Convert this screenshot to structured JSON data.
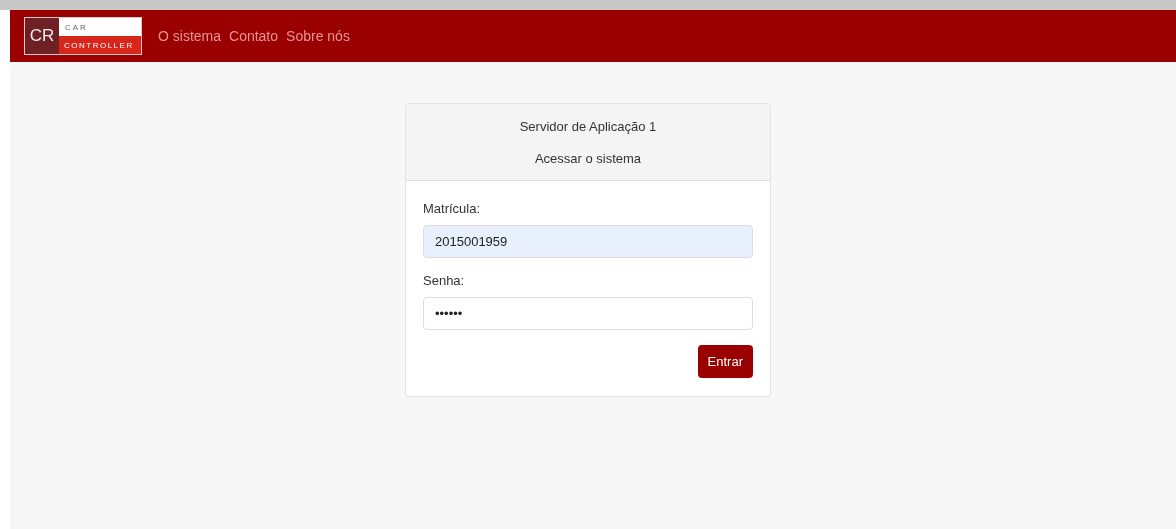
{
  "brand": {
    "initials": "CR",
    "line_1": "CAR",
    "line_2": "CONTROLLER"
  },
  "nav": [
    {
      "label": "O sistema"
    },
    {
      "label": "Contato"
    },
    {
      "label": "Sobre nós"
    }
  ],
  "card": {
    "title": "Servidor de Aplicação 1",
    "subtitle": "Acessar o sistema",
    "fields": [
      {
        "label": "Matrícula:",
        "value": "2015001959",
        "autofilled": true
      },
      {
        "label": "Senha:",
        "value": "••••••",
        "autofilled": false
      }
    ],
    "button": "Entrar"
  }
}
